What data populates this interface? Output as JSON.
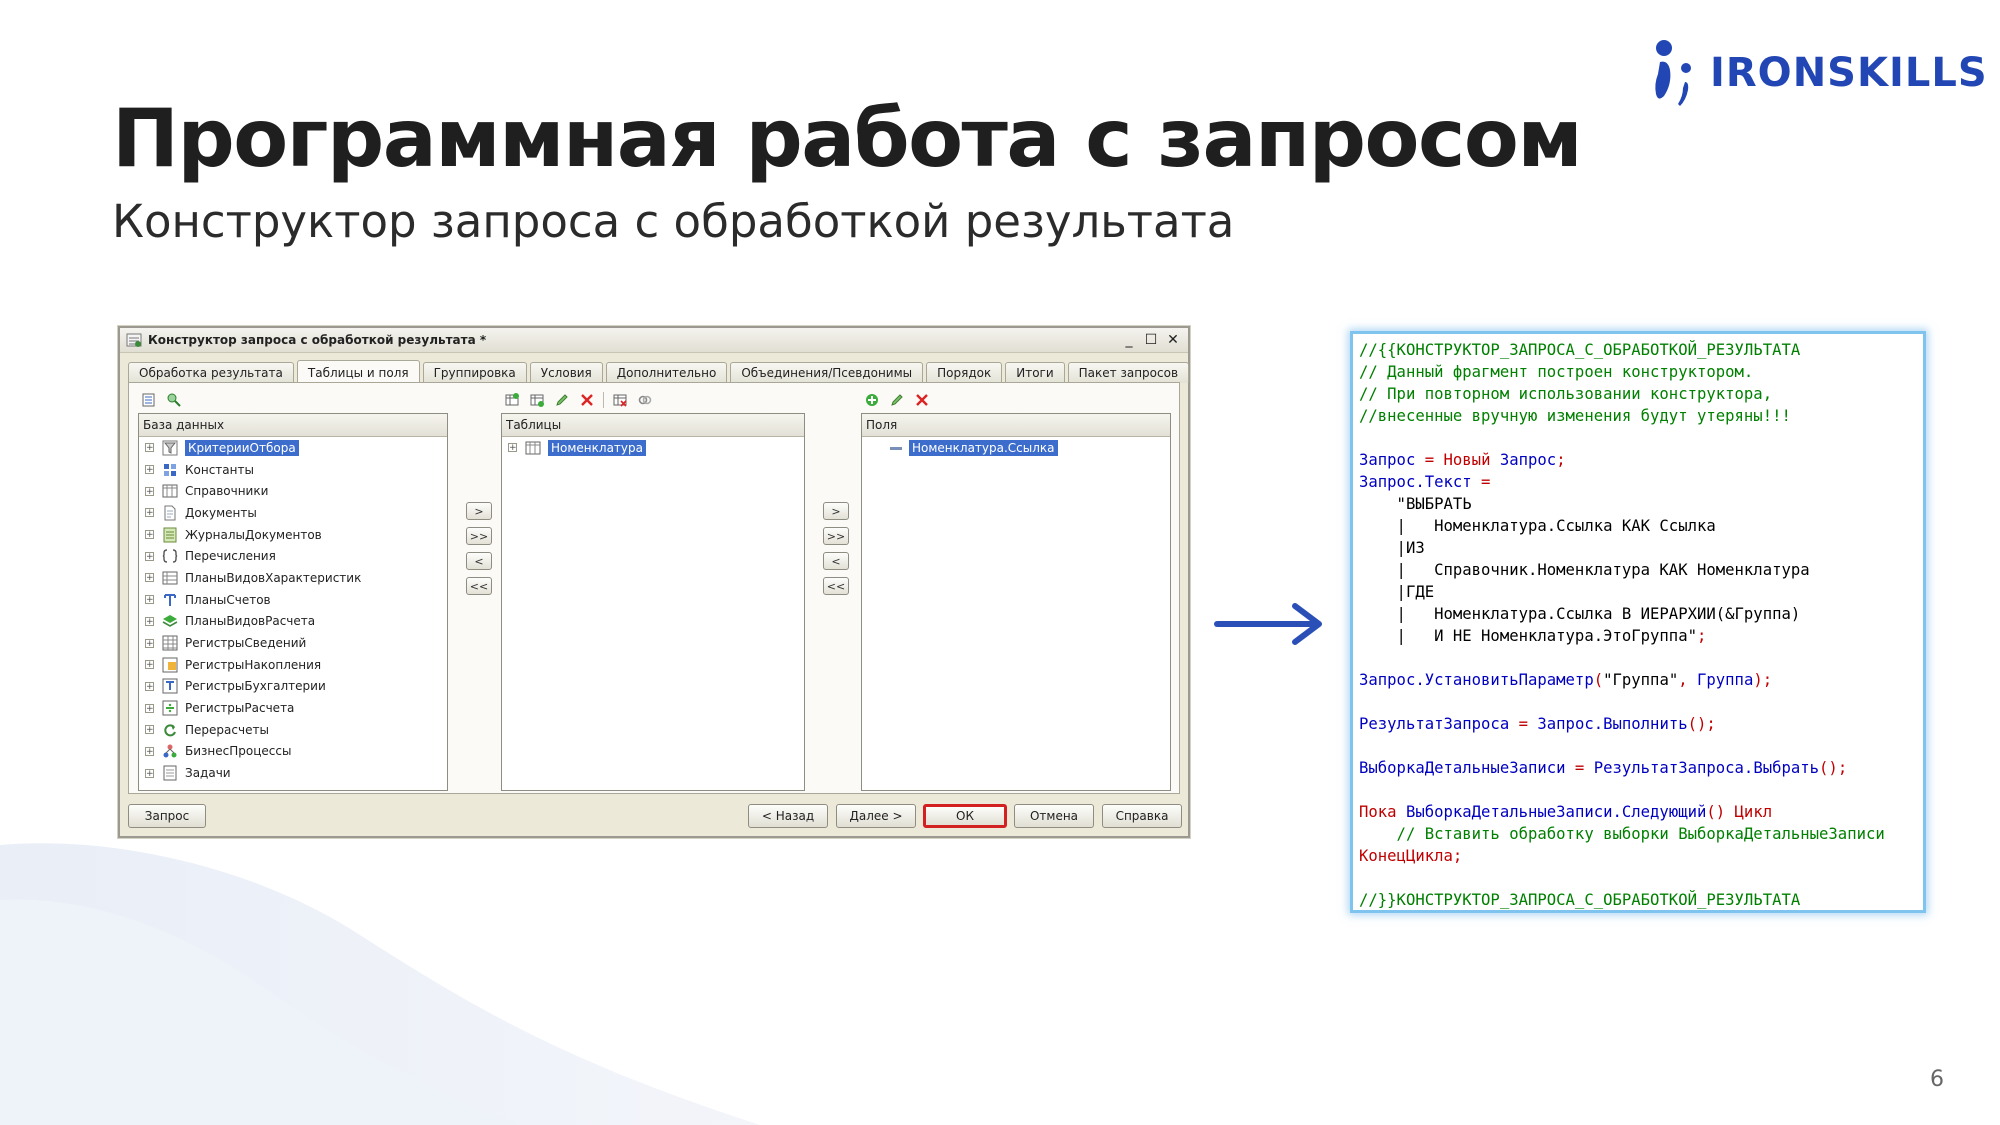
{
  "slide": {
    "title": "Программная работа с запросом",
    "subtitle": "Конструктор запроса с обработкой результата",
    "page_number": "6",
    "logo_text": "IRONSKILLS"
  },
  "window": {
    "title": "Конструктор запроса с обработкой результата *",
    "controls": [
      "_",
      "☐",
      "✕"
    ],
    "tabs": [
      {
        "label": "Обработка результата",
        "active": false
      },
      {
        "label": "Таблицы и поля",
        "active": true
      },
      {
        "label": "Группировка",
        "active": false
      },
      {
        "label": "Условия",
        "active": false
      },
      {
        "label": "Дополнительно",
        "active": false
      },
      {
        "label": "Объединения/Псевдонимы",
        "active": false
      },
      {
        "label": "Порядок",
        "active": false
      },
      {
        "label": "Итоги",
        "active": false
      },
      {
        "label": "Пакет запросов",
        "active": false
      }
    ],
    "database_panel": {
      "header": "База данных",
      "items": [
        {
          "label": "КритерииОтбора",
          "icon": "filter-criteria-icon",
          "selected": true
        },
        {
          "label": "Константы",
          "icon": "constants-icon",
          "selected": false
        },
        {
          "label": "Справочники",
          "icon": "catalog-icon",
          "selected": false
        },
        {
          "label": "Документы",
          "icon": "document-icon",
          "selected": false
        },
        {
          "label": "ЖурналыДокументов",
          "icon": "journal-icon",
          "selected": false
        },
        {
          "label": "Перечисления",
          "icon": "enum-icon",
          "selected": false
        },
        {
          "label": "ПланыВидовХарактеристик",
          "icon": "characteristic-plan-icon",
          "selected": false
        },
        {
          "label": "ПланыСчетов",
          "icon": "chart-of-accounts-icon",
          "selected": false
        },
        {
          "label": "ПланыВидовРасчета",
          "icon": "calculation-plan-icon",
          "selected": false
        },
        {
          "label": "РегистрыСведений",
          "icon": "info-register-icon",
          "selected": false
        },
        {
          "label": "РегистрыНакопления",
          "icon": "accumulation-register-icon",
          "selected": false
        },
        {
          "label": "РегистрыБухгалтерии",
          "icon": "accounting-register-icon",
          "selected": false
        },
        {
          "label": "РегистрыРасчета",
          "icon": "calculation-register-icon",
          "selected": false
        },
        {
          "label": "Перерасчеты",
          "icon": "recalculation-icon",
          "selected": false
        },
        {
          "label": "БизнесПроцессы",
          "icon": "business-process-icon",
          "selected": false
        },
        {
          "label": "Задачи",
          "icon": "task-icon",
          "selected": false
        }
      ]
    },
    "tables_panel": {
      "header": "Таблицы",
      "items": [
        {
          "label": "Номенклатура",
          "selected": true
        }
      ]
    },
    "fields_panel": {
      "header": "Поля",
      "items": [
        {
          "label": "Номенклатура.Ссылка",
          "selected": true
        }
      ]
    },
    "move_buttons": {
      "add": ">",
      "add_all": ">>",
      "remove": "<",
      "remove_all": "<<"
    },
    "bottom_buttons": {
      "query": "Запрос",
      "back": "< Назад",
      "next": "Далее >",
      "ok": "ОК",
      "cancel": "Отмена",
      "help": "Справка"
    }
  },
  "code": {
    "lines": [
      [
        {
          "t": "//{{КОНСТРУКТОР_ЗАПРОСА_С_ОБРАБОТКОЙ_РЕЗУЛЬТАТА",
          "c": "comment"
        }
      ],
      [
        {
          "t": "// Данный фрагмент построен конструктором.",
          "c": "comment"
        }
      ],
      [
        {
          "t": "// При повторном использовании конструктора,",
          "c": "comment"
        }
      ],
      [
        {
          "t": "//внесенные вручную изменения будут утеряны!!!",
          "c": "comment"
        }
      ],
      [],
      [
        {
          "t": "Запрос",
          "c": "ident"
        },
        {
          "t": " = ",
          "c": "keyword"
        },
        {
          "t": "Новый",
          "c": "keyword"
        },
        {
          "t": " Запрос",
          "c": "ident"
        },
        {
          "t": ";",
          "c": "keyword"
        }
      ],
      [
        {
          "t": "Запрос.Текст",
          "c": "ident"
        },
        {
          "t": " =",
          "c": "keyword"
        }
      ],
      [
        {
          "t": "    \"ВЫБРАТЬ",
          "c": "plain"
        }
      ],
      [
        {
          "t": "    |   Номенклатура.Ссылка КАК Ссылка",
          "c": "plain"
        }
      ],
      [
        {
          "t": "    |ИЗ",
          "c": "plain"
        }
      ],
      [
        {
          "t": "    |   Справочник.Номенклатура КАК Номенклатура",
          "c": "plain"
        }
      ],
      [
        {
          "t": "    |ГДЕ",
          "c": "plain"
        }
      ],
      [
        {
          "t": "    |   Номенклатура.Ссылка В ИЕРАРХИИ(&Группа)",
          "c": "plain"
        }
      ],
      [
        {
          "t": "    |   И НЕ Номенклатура.ЭтоГруппа\"",
          "c": "plain"
        },
        {
          "t": ";",
          "c": "keyword"
        }
      ],
      [],
      [
        {
          "t": "Запрос.УстановитьПараметр",
          "c": "ident"
        },
        {
          "t": "(",
          "c": "keyword"
        },
        {
          "t": "\"Группа\"",
          "c": "plain"
        },
        {
          "t": ", ",
          "c": "keyword"
        },
        {
          "t": "Группа",
          "c": "ident"
        },
        {
          "t": ");",
          "c": "keyword"
        }
      ],
      [],
      [
        {
          "t": "РезультатЗапроса",
          "c": "ident"
        },
        {
          "t": " = ",
          "c": "keyword"
        },
        {
          "t": "Запрос.Выполнить",
          "c": "ident"
        },
        {
          "t": "();",
          "c": "keyword"
        }
      ],
      [],
      [
        {
          "t": "ВыборкаДетальныеЗаписи",
          "c": "ident"
        },
        {
          "t": " = ",
          "c": "keyword"
        },
        {
          "t": "РезультатЗапроса.Выбрать",
          "c": "ident"
        },
        {
          "t": "();",
          "c": "keyword"
        }
      ],
      [],
      [
        {
          "t": "Пока",
          "c": "keyword"
        },
        {
          "t": " ВыборкаДетальныеЗаписи.Следующий",
          "c": "ident"
        },
        {
          "t": "() ",
          "c": "keyword"
        },
        {
          "t": "Цикл",
          "c": "keyword"
        }
      ],
      [
        {
          "t": "    // Вставить обработку выборки ВыборкаДетальныеЗаписи",
          "c": "comment"
        }
      ],
      [
        {
          "t": "КонецЦикла",
          "c": "keyword"
        },
        {
          "t": ";",
          "c": "keyword"
        }
      ],
      [],
      [
        {
          "t": "//}}КОНСТРУКТОР_ЗАПРОСА_С_ОБРАБОТКОЙ_РЕЗУЛЬТАТА",
          "c": "comment"
        }
      ]
    ]
  },
  "colors": {
    "title": "#1f1f1f",
    "logo": "#2247b4",
    "arrow": "#2a50b8",
    "code_border": "#7fc3ef",
    "code_comment": "#008000",
    "code_keyword": "#c00000",
    "code_ident": "#0000c0",
    "selection": "#3d6dcc",
    "ok_highlight": "#d32020"
  }
}
